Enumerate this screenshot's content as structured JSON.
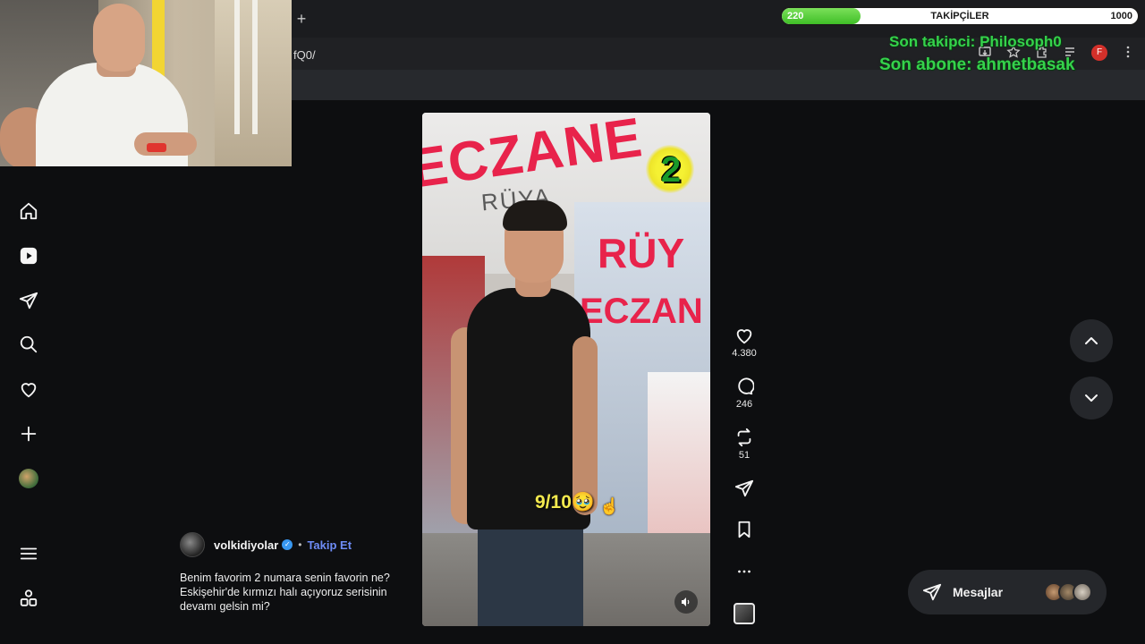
{
  "browser": {
    "new_tab_symbol": "+",
    "url_fragment": "fQ0/",
    "profile_initial": "F"
  },
  "stream_overlay": {
    "followers_label": "TAKİPÇİLER",
    "progress_start": "220",
    "progress_end": "1000",
    "progress_fraction": 0.22,
    "last_follower": "Son takipci: Philosoph0",
    "last_subscriber": "Son abone: ahmetbasak",
    "overlay_color": "#35d24b"
  },
  "sidebar": {
    "items": [
      {
        "icon": "home-icon"
      },
      {
        "icon": "reels-icon"
      },
      {
        "icon": "send-icon"
      },
      {
        "icon": "search-icon"
      },
      {
        "icon": "heart-icon"
      },
      {
        "icon": "plus-icon"
      },
      {
        "icon": "profile-avatar"
      },
      {
        "icon": "menu-icon"
      },
      {
        "icon": "apps-icon"
      }
    ]
  },
  "reel": {
    "sign_text": "ECZANE",
    "sign_sub": "RÜYA",
    "store_text_1": "RÜY",
    "store_text_2": "ECZAN",
    "badge_number": "2",
    "score_text": "9/10🥹",
    "actions": {
      "likes": "4.380",
      "comments": "246",
      "reposts": "51"
    }
  },
  "caption": {
    "username": "volkidiyolar",
    "separator": "•",
    "follow_label": "Takip Et",
    "text_line1": "Benim favorim 2 numara senin favorin ne?",
    "text_line2": "Eskişehir'de kırmızı halı açıyoruz serisinin",
    "text_line3": "devamı gelsin mi?"
  },
  "messages": {
    "label": "Mesajlar"
  },
  "colors": {
    "accent_link": "#6e8cf6",
    "verified": "#3897f0",
    "background": "#0d0e10"
  }
}
